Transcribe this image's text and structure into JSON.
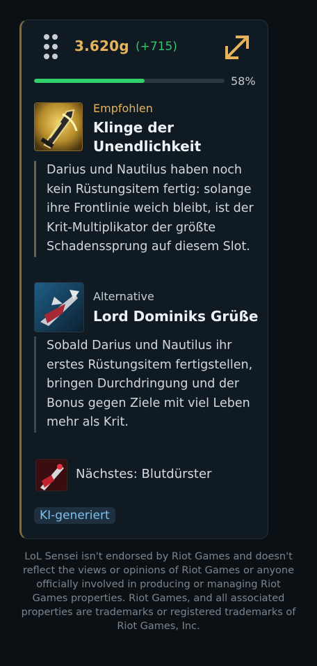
{
  "header": {
    "gold": "3.620g",
    "gold_diff": "(+715)",
    "progress_percent": 58,
    "progress_label": "58%"
  },
  "recommended": {
    "kicker": "Empfohlen",
    "name": "Klinge der Unendlichkeit",
    "reason": "Darius und Nautilus haben noch kein Rüstungsitem fertig: solange ihre Frontlinie weich bleibt, ist der Krit-Multiplikator der größte Schadenssprung auf diesem Slot."
  },
  "alternative": {
    "kicker": "Alternative",
    "name": "Lord Dominiks Grüße",
    "reason": "Sobald Darius und Nautilus ihr erstes Rüstungsitem fertigstellen, bringen Durchdringung und der Bonus gegen Ziele mit viel Leben mehr als Krit."
  },
  "next": {
    "label": "Nächstes: Blutdürster"
  },
  "badge": "KI-generiert",
  "disclaimer": "LoL Sensei isn't endorsed by Riot Games and doesn't reflect the views or opinions of Riot Games or anyone officially involved in producing or managing Riot Games properties. Riot Games, and all associated properties are trademarks or registered trademarks of Riot Games, Inc.",
  "colors": {
    "gold": "#e6b25c",
    "gain": "#35c46a",
    "progress": "#2fcf6c",
    "badge_text": "#7cc0ee"
  },
  "icons": {
    "drag": "drag-handle-icon",
    "expand": "expand-arrows-icon",
    "recommended_item": "infinity-edge-item-icon",
    "alternative_item": "lord-dominiks-regards-item-icon",
    "next_item": "bloodthirster-item-icon"
  }
}
